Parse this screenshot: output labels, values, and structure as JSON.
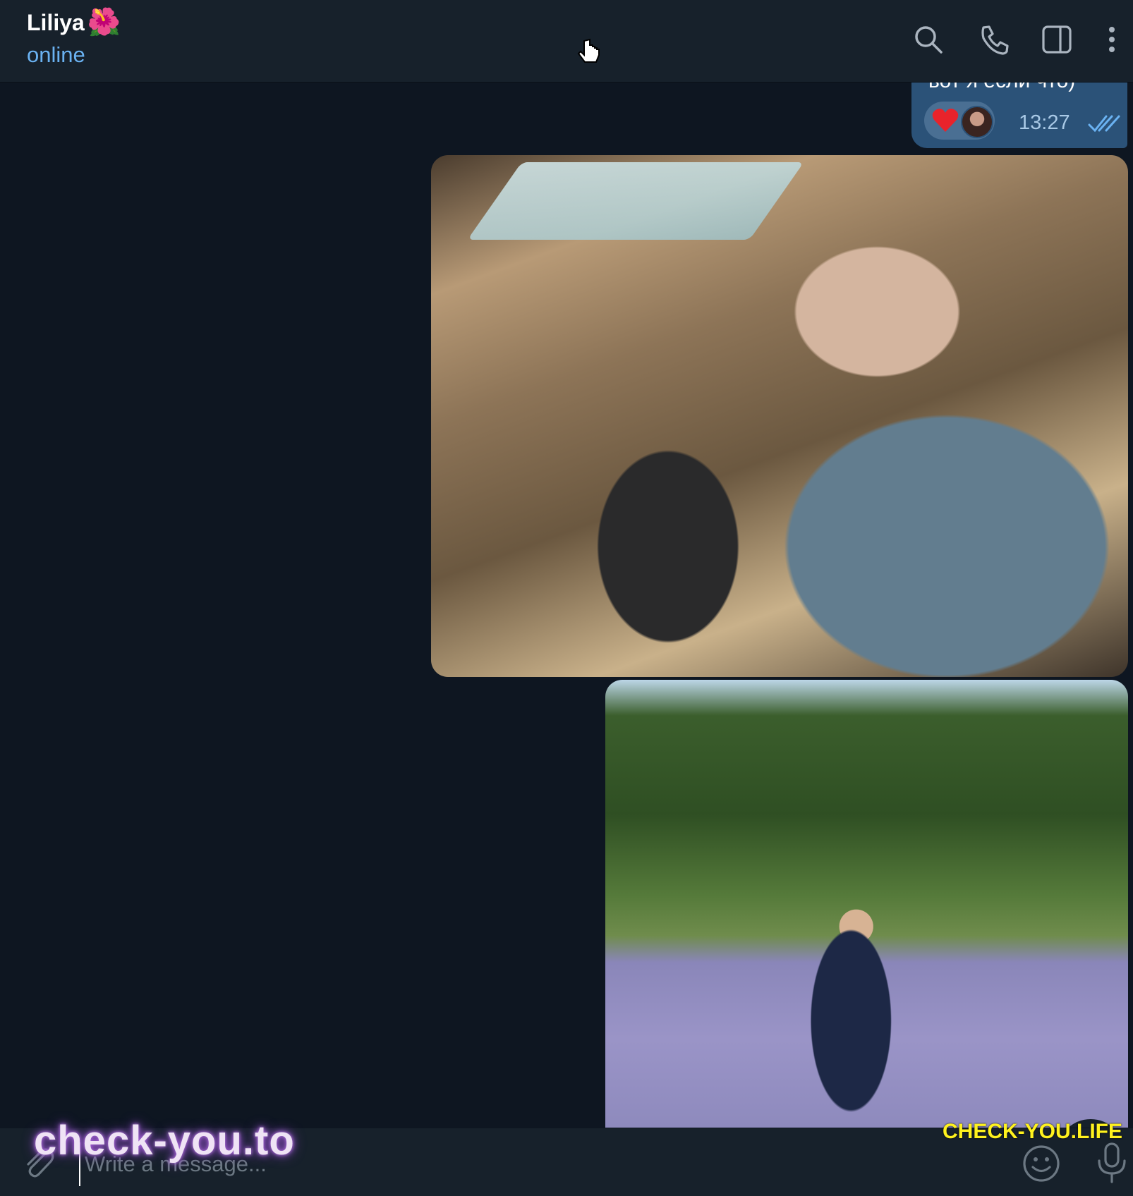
{
  "header": {
    "contact_name": "Liliya",
    "contact_emoji": "🌺",
    "status": "online",
    "icons": [
      "search-icon",
      "phone-icon",
      "sidebar-toggle-icon",
      "more-options-icon"
    ]
  },
  "messages": {
    "outgoing_text": "вот я если что)",
    "reaction_emoji": "❤️",
    "time": "13:27",
    "read_status": "double-check-icon"
  },
  "composer": {
    "placeholder": "Write a message..."
  },
  "watermarks": {
    "left": "check-you.to",
    "right": "CHECK-YOU.LIFE"
  },
  "colors": {
    "background": "#0e1621",
    "header_bg": "#17212b",
    "bubble_out": "#2b5278",
    "status_blue": "#6ab2f2"
  }
}
